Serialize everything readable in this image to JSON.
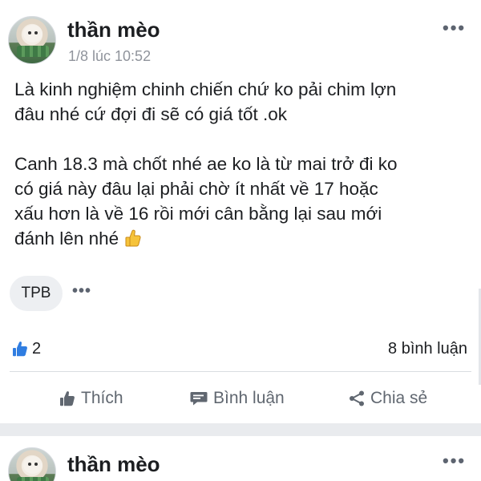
{
  "post1": {
    "author": "thần mèo",
    "timestamp": "1/8 lúc 10:52",
    "more_label": "•••",
    "text": {
      "para1_line1": "Là kinh nghiệm chinh chiến chứ ko pải chim lợn",
      "para1_line2": "đâu nhé cứ đợi đi sẽ có giá tốt .ok",
      "para2_line1": "Canh 18.3 mà chốt nhé ae ko là từ mai trở đi ko",
      "para2_line2": "có giá này đâu  lại phải chờ ít nhất về 17 hoặc",
      "para2_line3": "xấu hơn là về 16 rồi mới cân bằng lại sau mới",
      "para2_line4": "đánh lên nhé"
    },
    "emoji": "thumbs-up-emoji",
    "tag": "TPB",
    "tag_more": "•••",
    "like_count": "2",
    "comment_count": "8 bình luận",
    "actions": {
      "like": "Thích",
      "comment": "Bình luận",
      "share": "Chia sẻ"
    }
  },
  "post2": {
    "author": "thần mèo",
    "more_label": "•••"
  },
  "icons": {
    "like": "thumbs-up-icon",
    "comment": "comment-bubble-icon",
    "share": "share-icon",
    "reaction": "like-reaction-icon"
  },
  "colors": {
    "accent_like": "#2f7de1",
    "muted_text": "#90949c",
    "action_text": "#606770",
    "divider": "#e9ebee",
    "chip_bg": "#edeff2"
  }
}
